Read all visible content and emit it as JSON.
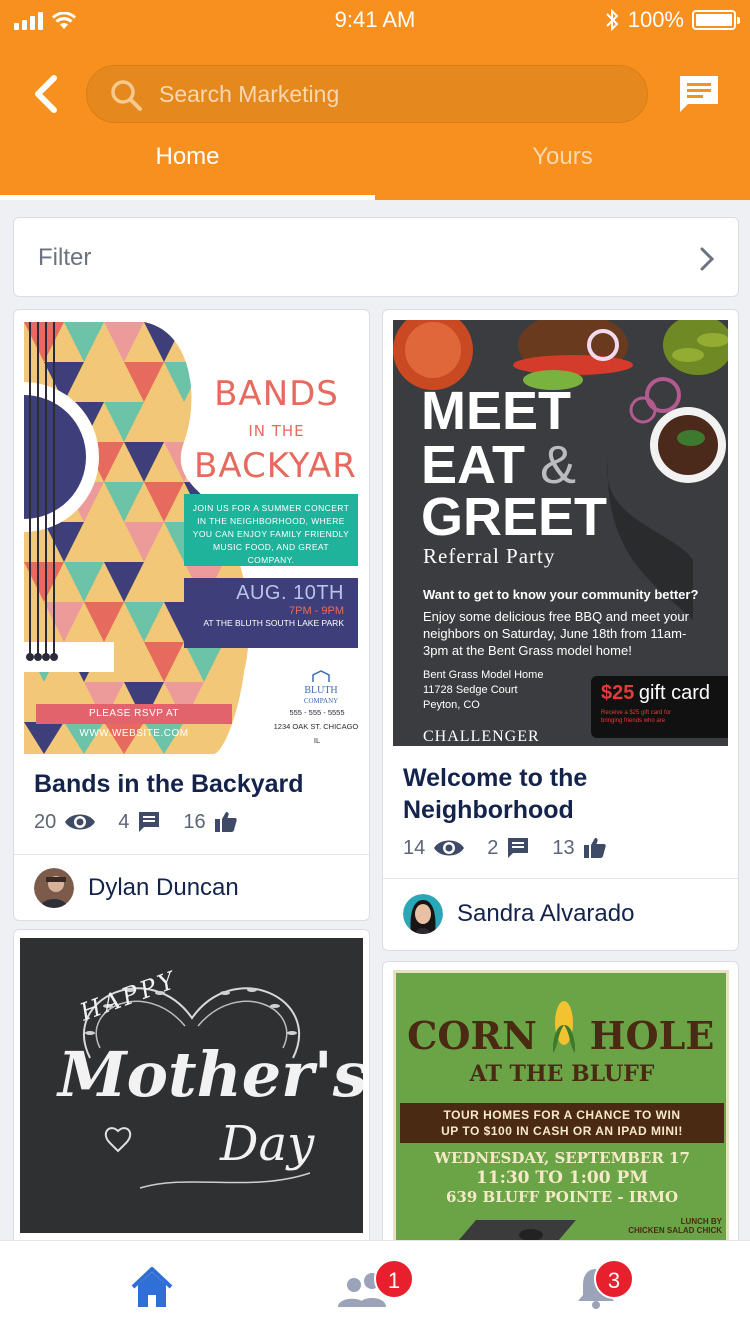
{
  "status_bar": {
    "time": "9:41 AM",
    "battery": "100%"
  },
  "header": {
    "search_placeholder": "Search Marketing",
    "tabs": [
      {
        "label": "Home",
        "active": true
      },
      {
        "label": "Yours",
        "active": false
      }
    ],
    "accent_color": "#f7901e"
  },
  "filter": {
    "label": "Filter"
  },
  "cards": [
    {
      "title": "Bands in the Backyard",
      "views": "20",
      "comments": "4",
      "likes": "16",
      "author": "Dylan Duncan",
      "poster": {
        "title_line1": "BANDS",
        "title_line2": "IN THE",
        "title_line3": "BACKYARD",
        "blurb": "JOIN US FOR A SUMMER CONCERT IN THE NEIGHBORHOOD, WHERE YOU CAN ENJOY FAMILY FRIENDLY MUSIC FOOD, AND GREAT COMPANY.",
        "date": "AUG. 10TH",
        "time": "7PM - 9PM",
        "location": "AT THE BLUTH SOUTH LAKE PARK",
        "logo_name": "BLUTH",
        "logo_sub": "COMPANY",
        "phone": "555 - 555 - 5555",
        "address": "1234 OAK ST. CHICAGO, IL",
        "rsvp": "PLEASE RSVP AT WWW.WEBSITE.COM"
      }
    },
    {
      "title": "Welcome to the Neighborhood",
      "views": "14",
      "comments": "2",
      "likes": "13",
      "author": "Sandra Alvarado",
      "poster": {
        "line1": "MEET",
        "line2": "EAT",
        "amp": "&",
        "line3": "GREET",
        "subtitle": "Referral Party",
        "question": "Want to get to know your community better?",
        "body": "Enjoy some delicious free BBQ and meet your neighbors on Saturday, June 18th from 11am-3pm at the Bent Grass model home!",
        "address_1": "Bent Grass Model Home",
        "address_2": "11728 Sedge Court",
        "address_3": "Peyton, CO",
        "gift_amount": "$25",
        "gift_text": "gift card",
        "gift_fine": "Receive a $25 gift card for bringing friends who are",
        "brand": "CHALLENGER"
      }
    },
    {
      "poster": {
        "line1": "HAPPY",
        "line2": "Mother's",
        "line3": "Day"
      }
    },
    {
      "poster": {
        "title1": "CORN",
        "title2": "HOLE",
        "title3": "AT THE BLUFF",
        "band_line1": "TOUR HOMES FOR A CHANCE TO WIN",
        "band_line2": "UP TO $100 IN CASH OR AN IPAD MINI!",
        "date": "WEDNESDAY, SEPTEMBER 17",
        "time": "11:30 TO 1:00 PM",
        "place": "639 BLUFF POINTE - IRMO",
        "lunch": "LUNCH BY",
        "sponsor": "CHICKEN SALAD CHICK"
      }
    }
  ],
  "bottom_nav": {
    "items": [
      {
        "icon": "home-icon",
        "active": true
      },
      {
        "icon": "people-icon",
        "badge": "1"
      },
      {
        "icon": "bell-icon",
        "badge": "3"
      }
    ],
    "active_color": "#2f6fd6",
    "inactive_color": "#9aa3b8",
    "badge_color": "#e8202e"
  }
}
